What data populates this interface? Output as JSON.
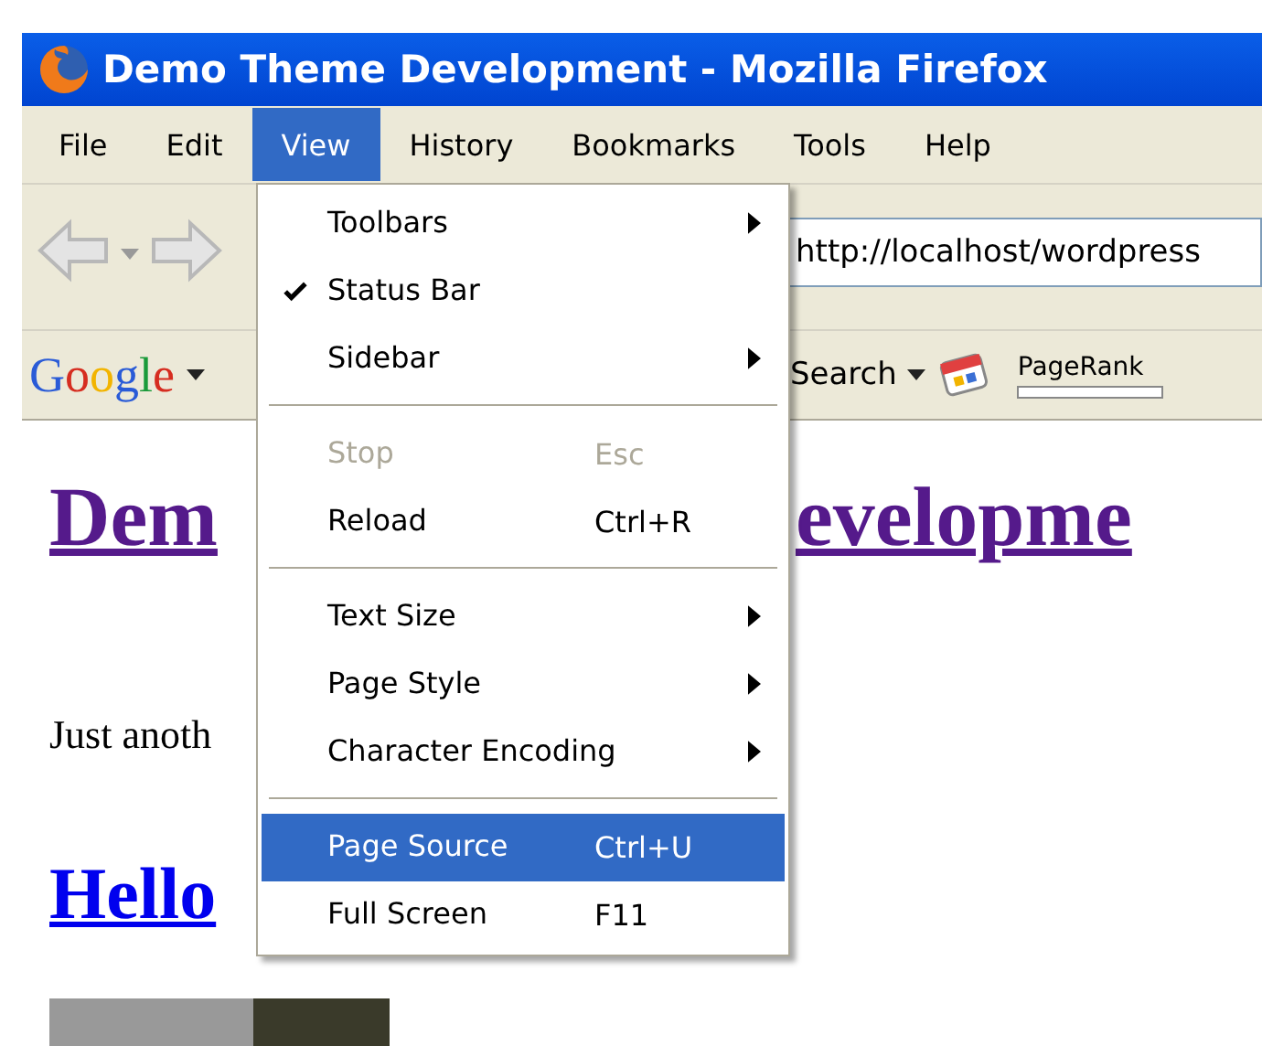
{
  "window": {
    "title": "Demo Theme Development - Mozilla Firefox"
  },
  "menu_bar": [
    {
      "label": "File",
      "selected": false
    },
    {
      "label": "Edit",
      "selected": false
    },
    {
      "label": "View",
      "selected": true
    },
    {
      "label": "History",
      "selected": false
    },
    {
      "label": "Bookmarks",
      "selected": false
    },
    {
      "label": "Tools",
      "selected": false
    },
    {
      "label": "Help",
      "selected": false
    }
  ],
  "address_bar": {
    "value": "http://localhost/wordpress"
  },
  "google_toolbar": {
    "logo": "Google",
    "search_label": "Search",
    "pagerank_label": "PageRank",
    "pagerank": {
      "level": 0
    }
  },
  "page": {
    "heading_parts": [
      "Dem",
      "evelopme"
    ],
    "tagline": "Just anoth",
    "post_title": "Hello"
  },
  "view_menu": [
    {
      "kind": "item",
      "label": "Toolbars",
      "submenu": true,
      "checked": false,
      "disabled": false,
      "selected": false
    },
    {
      "kind": "item",
      "label": "Status Bar",
      "submenu": false,
      "checked": true,
      "disabled": false,
      "selected": false
    },
    {
      "kind": "item",
      "label": "Sidebar",
      "submenu": true,
      "checked": false,
      "disabled": false,
      "selected": false
    },
    {
      "kind": "separator"
    },
    {
      "kind": "item",
      "label": "Stop",
      "shortcut": "Esc",
      "submenu": false,
      "checked": false,
      "disabled": true,
      "selected": false
    },
    {
      "kind": "item",
      "label": "Reload",
      "shortcut": "Ctrl+R",
      "submenu": false,
      "checked": false,
      "disabled": false,
      "selected": false
    },
    {
      "kind": "separator"
    },
    {
      "kind": "item",
      "label": "Text Size",
      "submenu": true,
      "checked": false,
      "disabled": false,
      "selected": false
    },
    {
      "kind": "item",
      "label": "Page Style",
      "submenu": true,
      "checked": false,
      "disabled": false,
      "selected": false
    },
    {
      "kind": "item",
      "label": "Character Encoding",
      "submenu": true,
      "checked": false,
      "disabled": false,
      "selected": false
    },
    {
      "kind": "separator"
    },
    {
      "kind": "item",
      "label": "Page Source",
      "shortcut": "Ctrl+U",
      "submenu": false,
      "checked": false,
      "disabled": false,
      "selected": true
    },
    {
      "kind": "item",
      "label": "Full Screen",
      "shortcut": "F11",
      "submenu": false,
      "checked": false,
      "disabled": false,
      "selected": false
    }
  ]
}
